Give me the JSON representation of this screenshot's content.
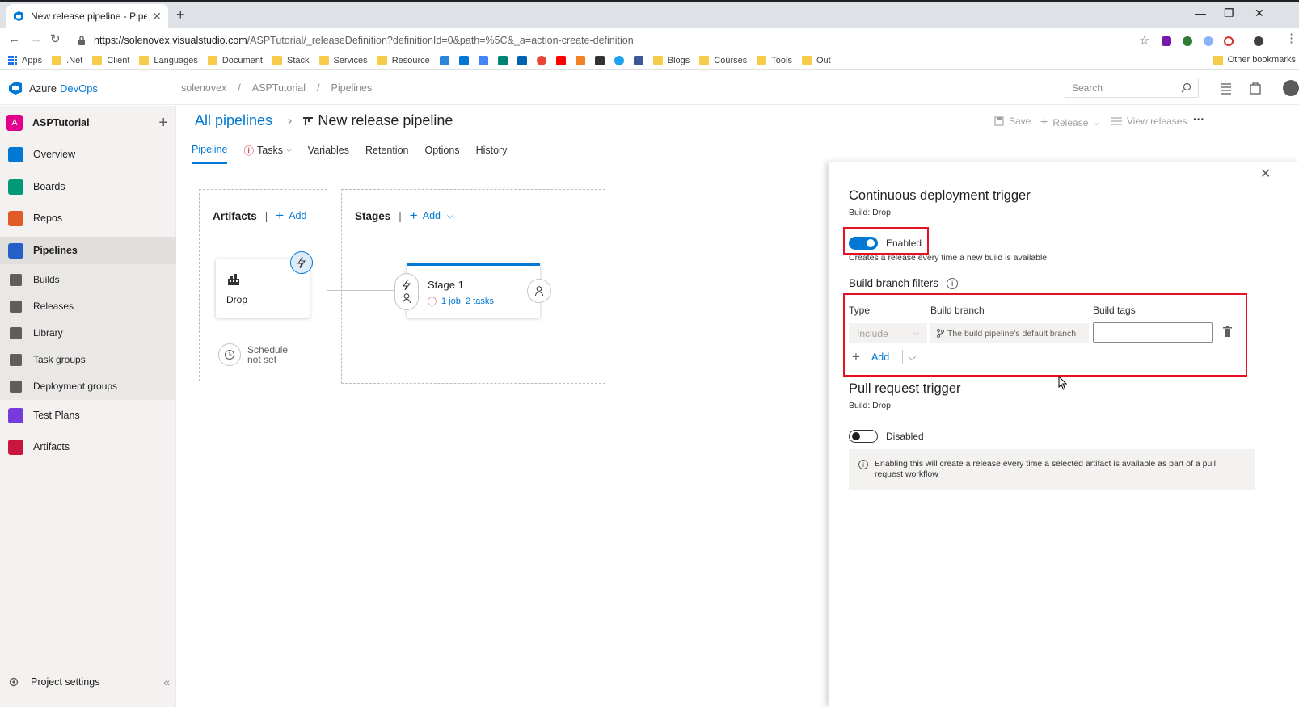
{
  "browser": {
    "tab_title": "New release pipeline - Pipelines",
    "url_host": "https://solenovex.visualstudio.com",
    "url_path": "/ASPTutorial/_releaseDefinition?definitionId=0&path=%5C&_a=action-create-definition",
    "bookmarks": [
      "Apps",
      ".Net",
      "Client",
      "Languages",
      "Document",
      "Stack",
      "Services",
      "Resource"
    ],
    "bookmarks2": [
      "Blogs",
      "Courses",
      "Tools",
      "Out"
    ],
    "other_bookmarks": "Other bookmarks"
  },
  "header": {
    "brand_part1": "Azure",
    "brand_part2": "DevOps",
    "breadcrumb": [
      "solenovex",
      "ASPTutorial",
      "Pipelines"
    ],
    "search_placeholder": "Search"
  },
  "sidebar": {
    "project_initial": "A",
    "project_name": "ASPTutorial",
    "items": [
      {
        "label": "Overview"
      },
      {
        "label": "Boards"
      },
      {
        "label": "Repos"
      },
      {
        "label": "Pipelines"
      },
      {
        "label": "Builds"
      },
      {
        "label": "Releases"
      },
      {
        "label": "Library"
      },
      {
        "label": "Task groups"
      },
      {
        "label": "Deployment groups"
      },
      {
        "label": "Test Plans"
      },
      {
        "label": "Artifacts"
      }
    ],
    "project_settings": "Project settings"
  },
  "page": {
    "all_pipelines": "All pipelines",
    "title": "New release pipeline",
    "commands": {
      "save": "Save",
      "release": "Release",
      "view_releases": "View releases",
      "more": "···"
    },
    "tabs": [
      "Pipeline",
      "Tasks",
      "Variables",
      "Retention",
      "Options",
      "History"
    ]
  },
  "canvas": {
    "artifacts_title": "Artifacts",
    "stages_title": "Stages",
    "add_label": "Add",
    "artifact_name": "Drop",
    "schedule_line1": "Schedule",
    "schedule_line2": "not set",
    "stage_name": "Stage 1",
    "stage_info": "1 job, 2 tasks"
  },
  "panel": {
    "cd_title": "Continuous deployment trigger",
    "cd_build": "Build: Drop",
    "cd_toggle_label": "Enabled",
    "cd_enabled": true,
    "cd_description": "Creates a release every time a new build is available.",
    "filters_title": "Build branch filters",
    "col_type": "Type",
    "col_branch": "Build branch",
    "col_tags": "Build tags",
    "type_value": "Include",
    "branch_value": "The build pipeline's default branch",
    "tags_value": "",
    "add_label": "Add",
    "pr_title": "Pull request trigger",
    "pr_build": "Build: Drop",
    "pr_toggle_label": "Disabled",
    "pr_enabled": false,
    "pr_note": "Enabling this will create a release every time a selected artifact is available as part of a pull request workflow"
  },
  "colors": {
    "accent": "#0078d4",
    "highlight": "#e81123",
    "warning": "#c50f1f"
  }
}
